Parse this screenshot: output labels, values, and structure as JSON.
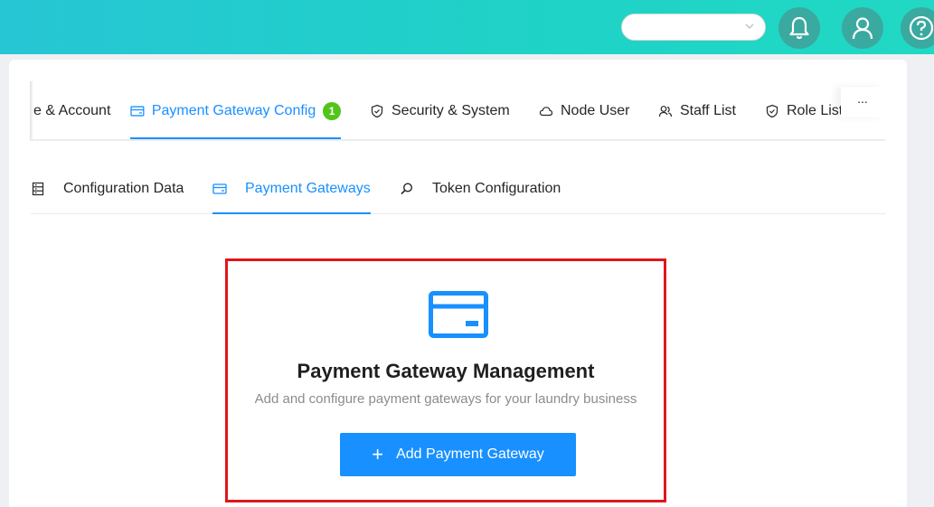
{
  "header": {
    "language_select": {
      "value": "",
      "icon": "chevron-down-icon"
    },
    "notification_icon": "bell-icon",
    "profile_icon": "user-icon",
    "help_icon": "question-icon",
    "brand_colors": [
      "#26c6d4",
      "#20d8c4"
    ]
  },
  "main_tabs": [
    {
      "label": "e & Account",
      "icon": "",
      "active": false
    },
    {
      "label": "Payment Gateway Config",
      "icon": "credit-card-icon",
      "active": true,
      "badge": "1"
    },
    {
      "label": "Security & System",
      "icon": "shield-icon",
      "active": false
    },
    {
      "label": "Node User",
      "icon": "cloud-icon",
      "active": false
    },
    {
      "label": "Staff List",
      "icon": "team-icon",
      "active": false
    },
    {
      "label": "Role List",
      "icon": "shield-icon",
      "active": false
    }
  ],
  "more_label": "...",
  "sub_tabs": [
    {
      "label": "Configuration Data",
      "icon": "database-icon",
      "active": false
    },
    {
      "label": "Payment Gateways",
      "icon": "credit-card-icon",
      "active": true
    },
    {
      "label": "Token Configuration",
      "icon": "search-icon",
      "active": false
    }
  ],
  "empty_state": {
    "icon": "credit-card-icon",
    "title": "Payment Gateway Management",
    "subtitle": "Add and configure payment gateways for your laundry business",
    "button_label": "Add Payment Gateway",
    "button_icon": "plus-icon"
  },
  "colors": {
    "accent": "#1890ff",
    "badge": "#52c41a",
    "highlight": "#e0161b"
  }
}
